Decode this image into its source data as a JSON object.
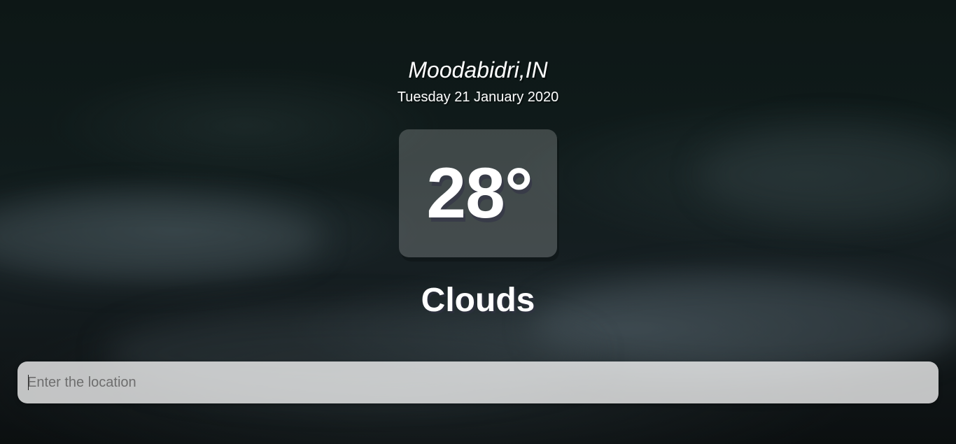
{
  "location": "Moodabidri,IN",
  "date": "Tuesday 21 January 2020",
  "temperature": "28°",
  "weather": "Clouds",
  "search": {
    "placeholder": "Enter the location",
    "value": ""
  }
}
